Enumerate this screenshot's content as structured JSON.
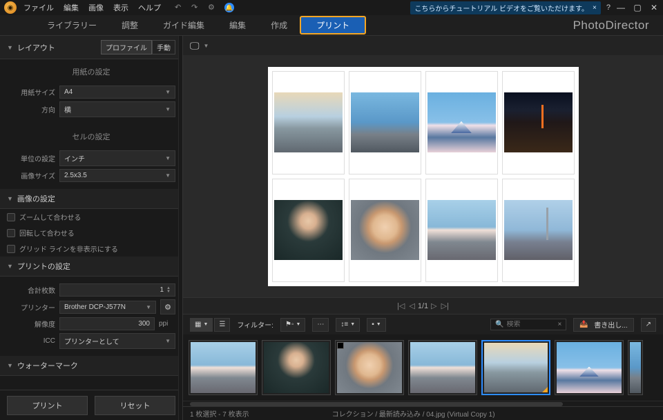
{
  "menu": {
    "file": "ファイル",
    "edit": "編集",
    "image": "画像",
    "view": "表示",
    "help": "ヘルプ"
  },
  "tutorial_bar": {
    "text": "こちらからチュートリアル ビデオをご覧いただけます。",
    "close": "×"
  },
  "help_icon": "?",
  "tabs": {
    "library": "ライブラリー",
    "adjust": "調整",
    "guided": "ガイド編集",
    "edit": "編集",
    "create": "作成",
    "print": "プリント"
  },
  "app_title": "PhotoDirector",
  "sidebar": {
    "layout": {
      "title": "レイアウト",
      "profile": "プロファイル",
      "manual": "手動"
    },
    "paper": {
      "title": "用紙の設定",
      "size_label": "用紙サイズ",
      "size_value": "A4",
      "orient_label": "方向",
      "orient_value": "横"
    },
    "cell": {
      "title": "セルの設定",
      "unit_label": "単位の設定",
      "unit_value": "インチ",
      "imgsize_label": "画像サイズ",
      "imgsize_value": "2.5x3.5"
    },
    "image": {
      "title": "画像の設定",
      "zoom": "ズームして合わせる",
      "rotate": "回転して合わせる",
      "grid": "グリッド ラインを非表示にする"
    },
    "print": {
      "title": "プリントの設定",
      "count_label": "合計枚数",
      "count_value": "1",
      "printer_label": "プリンター",
      "printer_value": "Brother DCP-J577N",
      "res_label": "解像度",
      "res_value": "300",
      "res_unit": "ppi",
      "icc_label": "ICC",
      "icc_value": "プリンターとして"
    },
    "watermark": {
      "title": "ウォーターマーク"
    },
    "footer": {
      "print": "プリント",
      "reset": "リセット"
    }
  },
  "preview": {
    "page_nav": "1/1",
    "display_icon": "⛶"
  },
  "filter_bar": {
    "filter_label": "フィルター:",
    "search_placeholder": "検索",
    "export": "書き出し..."
  },
  "status": {
    "selection": "1 枚選択 - 7 枚表示",
    "path": "コレクション / 最新読み込み / 04.jpg (Virtual Copy 1)"
  }
}
